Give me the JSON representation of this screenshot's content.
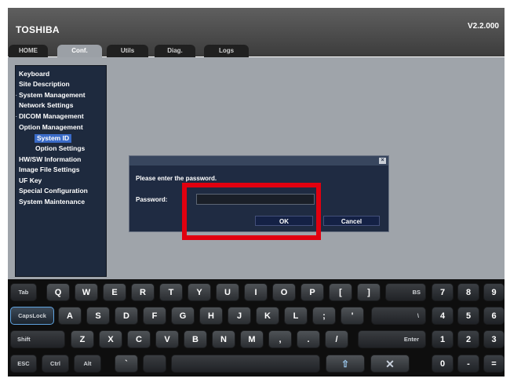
{
  "header": {
    "brand": "TOSHIBA",
    "version": "V2.2.000"
  },
  "tabs": [
    {
      "label": "HOME",
      "active": false
    },
    {
      "label": "Conf.",
      "active": true
    },
    {
      "label": "Utils",
      "active": false
    },
    {
      "label": "Diag.",
      "active": false
    },
    {
      "label": "Logs",
      "active": false
    }
  ],
  "sidebar": {
    "items": [
      {
        "label": "Keyboard"
      },
      {
        "label": "Site Description"
      },
      {
        "label": "System Management",
        "expander": "+"
      },
      {
        "label": "Network Settings"
      },
      {
        "label": "DICOM Management",
        "expander": "+"
      },
      {
        "label": "Option Management",
        "expander": "-"
      },
      {
        "label": "System ID",
        "sub": true,
        "selected": true
      },
      {
        "label": "Option Settings",
        "sub": true
      },
      {
        "label": "HW/SW Information"
      },
      {
        "label": "Image File Settings"
      },
      {
        "label": "UF Key"
      },
      {
        "label": "Special Configuration"
      },
      {
        "label": "System Maintenance"
      }
    ]
  },
  "dialog": {
    "close_glyph": "×",
    "prompt": "Please enter the password.",
    "password_label": "Password:",
    "password_value": "",
    "ok_label": "OK",
    "cancel_label": "Cancel"
  },
  "keyboard": {
    "row1": [
      "Tab",
      "Q",
      "W",
      "E",
      "R",
      "T",
      "Y",
      "U",
      "I",
      "O",
      "P",
      "[",
      "]",
      "BS",
      "7",
      "8",
      "9"
    ],
    "row2": [
      "CapsLock",
      "A",
      "S",
      "D",
      "F",
      "G",
      "H",
      "J",
      "K",
      "L",
      ";",
      "'",
      "\\",
      "4",
      "5",
      "6"
    ],
    "row3": [
      "Shift",
      "Z",
      "X",
      "C",
      "V",
      "B",
      "N",
      "M",
      ",",
      ".",
      "/",
      "Enter",
      "1",
      "2",
      "3"
    ],
    "row4": [
      "ESC",
      "Ctrl",
      "Alt",
      "`",
      "",
      "",
      "⇧",
      "✕",
      "0",
      "-",
      "="
    ]
  },
  "colors": {
    "highlight": "#e1000f",
    "sidebar_bg": "#1e2a3e",
    "selected": "#3a6bc8"
  }
}
